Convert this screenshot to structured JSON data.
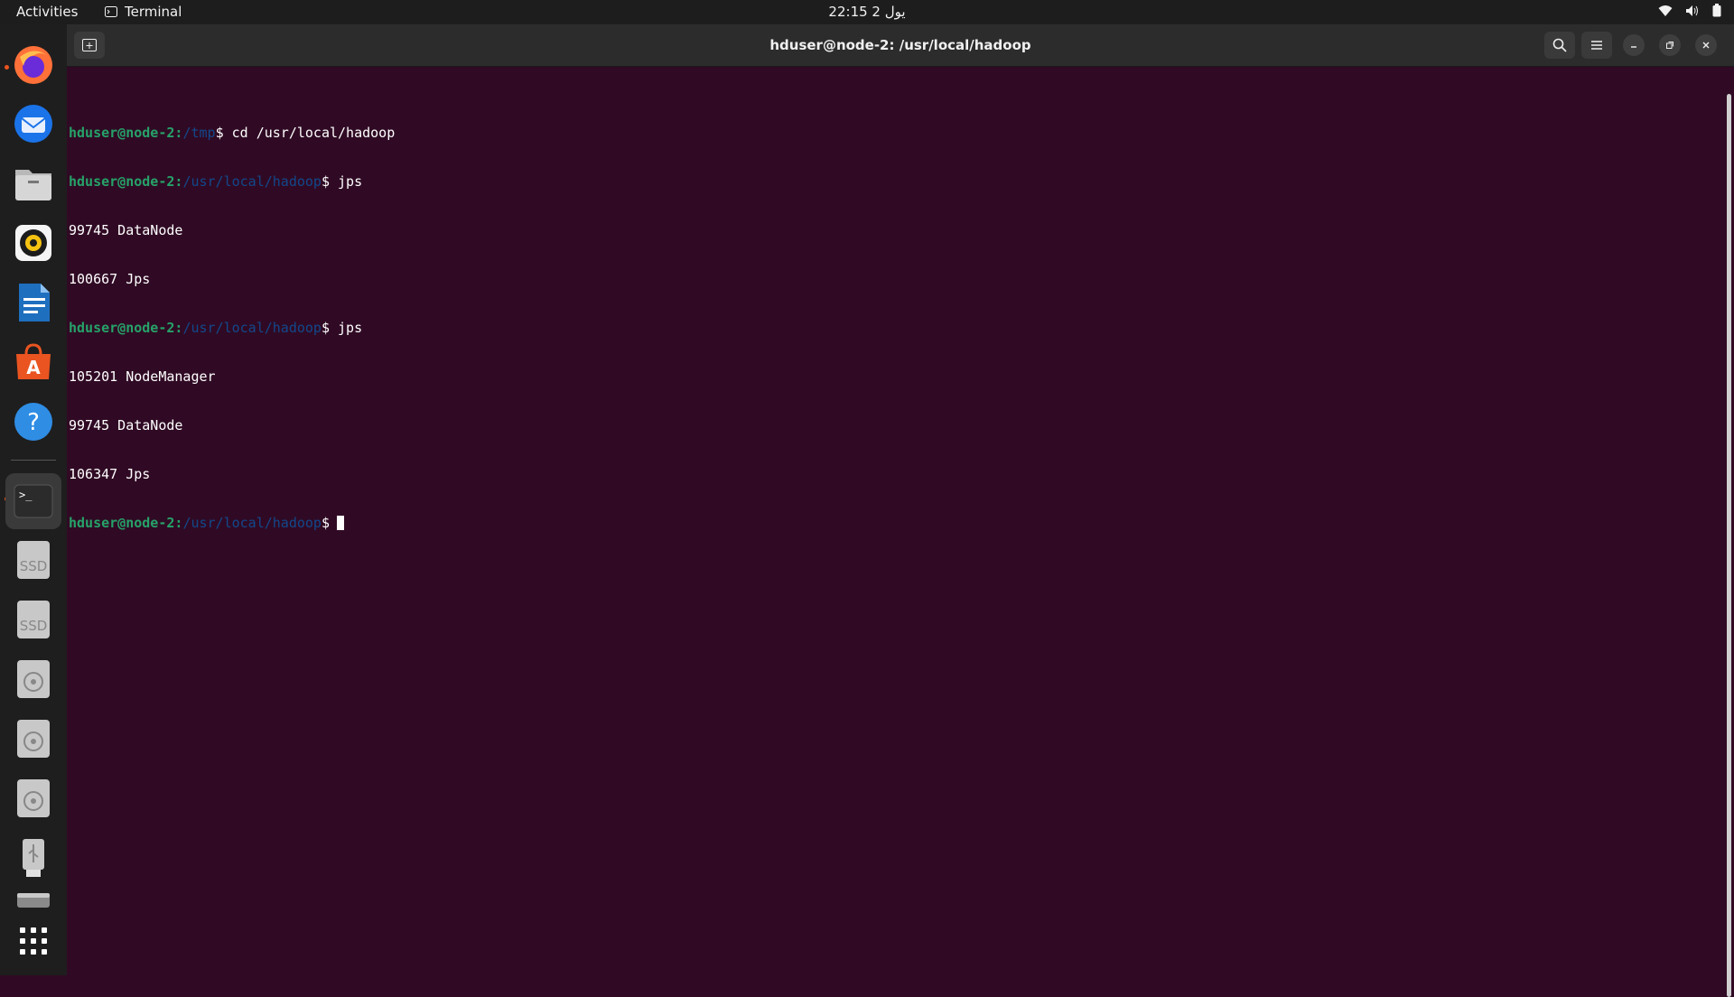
{
  "topbar": {
    "activities": "Activities",
    "app_name": "Terminal",
    "clock": "22:15  يول 2",
    "icons": [
      "wifi-icon",
      "volume-icon",
      "battery-icon"
    ]
  },
  "dock": {
    "items": [
      {
        "name": "firefox",
        "running": true
      },
      {
        "name": "thunderbird",
        "running": false
      },
      {
        "name": "files",
        "running": false
      },
      {
        "name": "rhythmbox",
        "running": false
      },
      {
        "name": "libreoffice-writer",
        "running": false
      },
      {
        "name": "ubuntu-software",
        "running": false
      },
      {
        "name": "help",
        "running": false
      },
      {
        "name": "terminal",
        "running": true
      },
      {
        "name": "ssd-drive",
        "label": "SSD"
      },
      {
        "name": "ssd-drive",
        "label": "SSD"
      },
      {
        "name": "optical-drive"
      },
      {
        "name": "optical-drive"
      },
      {
        "name": "optical-drive"
      },
      {
        "name": "usb-drive"
      },
      {
        "name": "disk-drive"
      },
      {
        "name": "show-apps"
      }
    ],
    "ssd_label": "SSD"
  },
  "window": {
    "title": "hduser@node-2: /usr/local/hadoop"
  },
  "terminal": {
    "prompt_user": "hduser@node-2",
    "lines": [
      {
        "type": "prompt",
        "path": "/tmp",
        "cmd": " cd /usr/local/hadoop"
      },
      {
        "type": "prompt",
        "path": "/usr/local/hadoop",
        "cmd": " jps"
      },
      {
        "type": "output",
        "text": "99745 DataNode"
      },
      {
        "type": "output",
        "text": "100667 Jps"
      },
      {
        "type": "prompt",
        "path": "/usr/local/hadoop",
        "cmd": " jps"
      },
      {
        "type": "output",
        "text": "105201 NodeManager"
      },
      {
        "type": "output",
        "text": "99745 DataNode"
      },
      {
        "type": "output",
        "text": "106347 Jps"
      },
      {
        "type": "prompt",
        "path": "/usr/local/hadoop",
        "cmd": "",
        "cursor": true
      }
    ]
  },
  "colors": {
    "terminal_bg": "#300a24",
    "prompt_user": "#26a269",
    "prompt_path": "#12488b",
    "accent": "#e95420"
  }
}
